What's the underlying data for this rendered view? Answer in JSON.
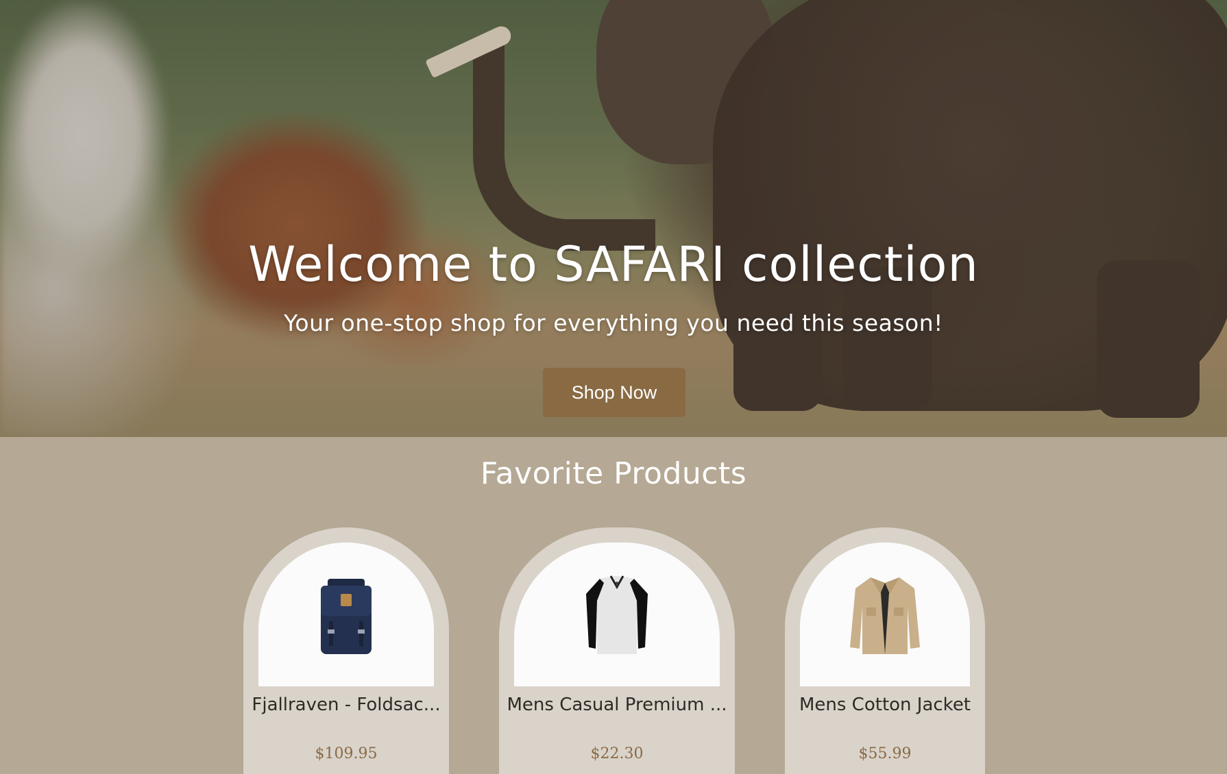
{
  "hero": {
    "title": "Welcome to SAFARI collection",
    "subtitle": "Your one-stop shop for everything you need this season!",
    "cta_label": "Shop Now"
  },
  "favorites": {
    "title": "Favorite Products",
    "products": [
      {
        "name": "Fjallraven - Foldsac...",
        "price": "$109.95",
        "icon": "backpack-image"
      },
      {
        "name": "Mens Casual Premium ...",
        "price": "$22.30",
        "icon": "raglan-shirt-image"
      },
      {
        "name": "Mens Cotton Jacket",
        "price": "$55.99",
        "icon": "cotton-jacket-image"
      }
    ]
  },
  "colors": {
    "accent": "#896a43",
    "section_bg": "#b5a894",
    "card_bg": "#d9d3ca",
    "price": "#8a6a45"
  }
}
